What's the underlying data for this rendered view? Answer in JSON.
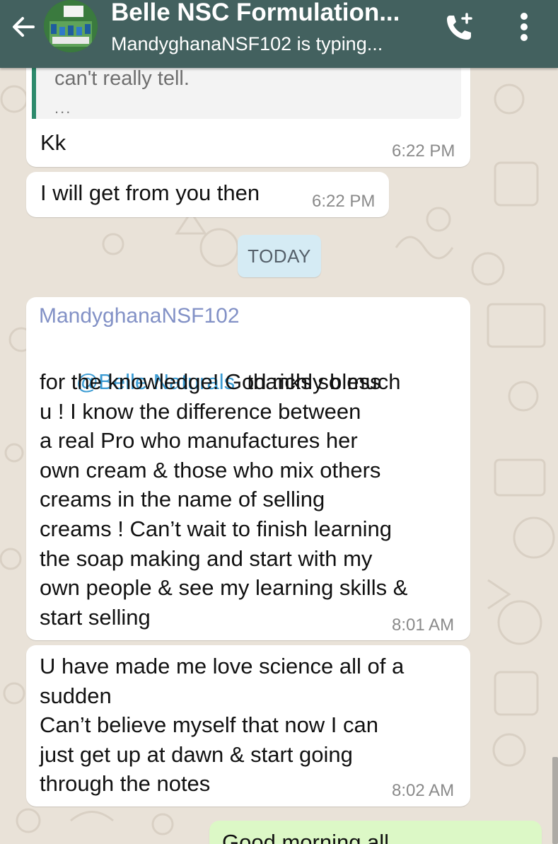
{
  "header": {
    "title": "Belle NSC Formulation...",
    "subtitle": "MandyghanaNSF102 is typing...",
    "avatar_text": "Belle Naturals training",
    "bar_color": "#43615f"
  },
  "icons": {
    "back": "arrow-left-icon",
    "call": "add-call-icon",
    "menu": "more-vertical-icon"
  },
  "messages": {
    "m1": {
      "quote_text": "can't really tell.",
      "quote_more": "...",
      "text": "Kk",
      "time": "6:22 PM"
    },
    "m2": {
      "text": "I will get from you then",
      "time": "6:22 PM"
    },
    "day_divider": "TODAY",
    "m3": {
      "sender": "MandyghanaNSF102",
      "mention": "@Belle Naturals",
      "line1_rest": "  thanks so much",
      "body": "for the knowledge! God richly bless\nu ! I know the difference between\na real Pro who manufactures her\nown cream & those who mix others\ncreams in the name of selling\ncreams ! Can’t wait to finish learning\nthe soap making and start with my\nown people & see my learning skills &\nstart selling",
      "time": "8:01 AM"
    },
    "m4": {
      "text": "U have made me love science all of a\nsudden\nCan’t believe myself that now I can\njust get up at dawn & start going\nthrough the notes",
      "time": "8:02 AM"
    },
    "m5": {
      "text": "Good morning all"
    }
  },
  "colors": {
    "outgoing_bubble": "#dcf8c6",
    "incoming_bubble": "#ffffff",
    "sender_name": "#8291c6",
    "mention": "#3a9bd3",
    "day_chip": "#d5ebf4"
  }
}
